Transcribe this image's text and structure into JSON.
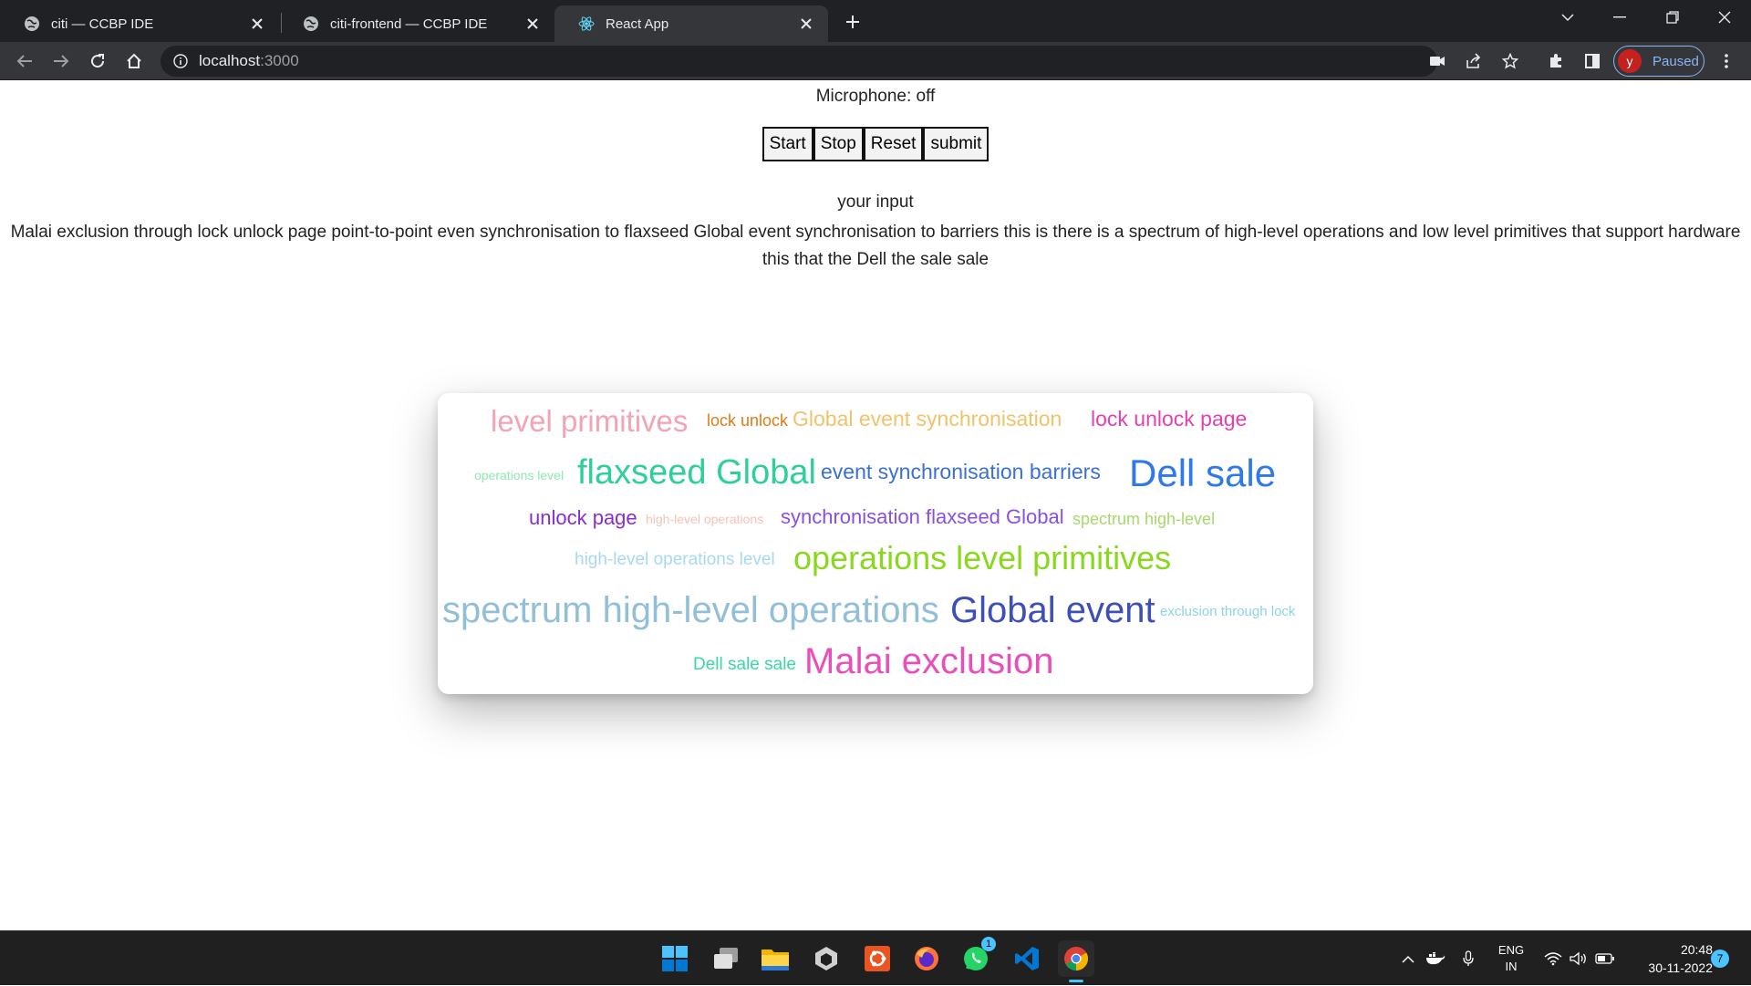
{
  "browser": {
    "tabs": [
      {
        "title": "citi — CCBP IDE",
        "active": false,
        "icon": "globe-icon"
      },
      {
        "title": "citi-frontend — CCBP IDE",
        "active": false,
        "icon": "globe-icon"
      },
      {
        "title": "React App",
        "active": true,
        "icon": "react-icon"
      }
    ],
    "address": {
      "host": "localhost",
      "port": ":3000"
    },
    "profile": {
      "initial": "y",
      "status": "Paused"
    }
  },
  "page": {
    "mic_status": "Microphone: off",
    "buttons": {
      "start": "Start",
      "stop": "Stop",
      "reset": "Reset",
      "submit": "submit"
    },
    "input_label": "your input",
    "transcript": "Malai exclusion through lock unlock page point-to-point even synchronisation to flaxseed Global event synchronisation to barriers this is there is a spectrum of high-level operations and low level primitives that support hardware this that the Dell the sale sale"
  },
  "word_cloud": {
    "words": [
      {
        "text": "level primitives",
        "color": "#f4a3b4"
      },
      {
        "text": "lock unlock",
        "color": "#e07b16"
      },
      {
        "text": "Global event synchronisation",
        "color": "#f0c36a"
      },
      {
        "text": "lock unlock page",
        "color": "#e83fb0"
      },
      {
        "text": "operations level",
        "color": "#8fe8b0"
      },
      {
        "text": "flaxseed Global",
        "color": "#2fcf9a"
      },
      {
        "text": "event synchronisation barriers",
        "color": "#3a6fd8"
      },
      {
        "text": "Dell sale",
        "color": "#2f7ae8"
      },
      {
        "text": "unlock page",
        "color": "#8a2bd6"
      },
      {
        "text": "high-level operations",
        "color": "#f6c2b4"
      },
      {
        "text": "synchronisation flaxseed Global",
        "color": "#8a4fe0"
      },
      {
        "text": "spectrum high-level",
        "color": "#a7d86a"
      },
      {
        "text": "high-level operations level",
        "color": "#a8d8f0"
      },
      {
        "text": "operations level primitives",
        "color": "#8ad81e"
      },
      {
        "text": "spectrum high-level operations",
        "color": "#92bfd8"
      },
      {
        "text": "Global event",
        "color": "#3d4fb8"
      },
      {
        "text": "exclusion through lock",
        "color": "#8cd3e8"
      },
      {
        "text": "Dell sale sale",
        "color": "#3ad8a0"
      },
      {
        "text": "Malai exclusion",
        "color": "#e84fb8"
      }
    ]
  },
  "taskbar": {
    "apps": [
      "windows-start-icon",
      "task-view-icon",
      "file-explorer-icon",
      "unity-icon",
      "ubuntu-icon",
      "firefox-icon",
      "whatsapp-icon",
      "vscode-icon",
      "chrome-icon"
    ],
    "whatsapp_badge": "1",
    "language": {
      "line1": "ENG",
      "line2": "IN"
    },
    "clock": {
      "time": "20:48",
      "date": "30-11-2022"
    },
    "notification_count": "7"
  }
}
